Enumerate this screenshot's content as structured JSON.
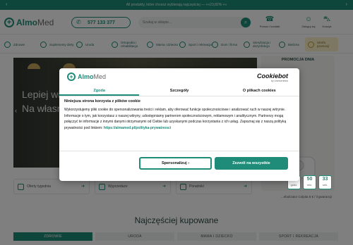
{
  "topbar": {
    "text": "All produkty, które chcesz wybierają najczęściej — +»23,82% +«",
    "prev": "‹",
    "next": "›"
  },
  "header": {
    "logo_a": "Almo",
    "logo_b": "Med",
    "phone": "577 133 377",
    "search_placeholder": "Szukaj w sklepie...",
    "icons": [
      {
        "name": "kontakt",
        "label": "Pomoc i kontakt",
        "glyph": "☎"
      },
      {
        "name": "account",
        "label": "Zaloguj się",
        "glyph": "☺"
      },
      {
        "name": "cart",
        "label": "Koszyk",
        "glyph": "⛍"
      }
    ]
  },
  "categories": [
    {
      "label": "Zdrowie"
    },
    {
      "label": "Suplementy diety"
    },
    {
      "label": "Uroda"
    },
    {
      "label": "Ortopedia i rehabilitacja"
    },
    {
      "label": "Mama i dziecko"
    },
    {
      "label": "Sport i rekreacja"
    },
    {
      "label": "Dom i firma"
    },
    {
      "label": "Sterylizacja i dezynfekcja"
    },
    {
      "label": "Bielizna"
    },
    {
      "label": "Strefa promocji"
    }
  ],
  "hero": {
    "title_line1": "Lepiej wi",
    "title_line2": "Na własn"
  },
  "promo": {
    "title": "PROMOCJA DNIA",
    "product_name": "…ebulizator Colpita 8 € / il gwarancji",
    "countdown": [
      {
        "value": "12",
        "unit": "godz."
      },
      {
        "value": "50",
        "unit": "min."
      },
      {
        "value": "33",
        "unit": "sek."
      }
    ]
  },
  "tiles": [
    {
      "label": "Oferty tygodnia"
    },
    {
      "label": "Wyprzedaże"
    },
    {
      "label": "Poradniki"
    }
  ],
  "section": {
    "title": "Najczęściej kupowane",
    "tabs": [
      "ZDROWIE",
      "URODA",
      "MAMA I DZIECKO",
      "SPORT I REKREACJA"
    ]
  },
  "cookie": {
    "logo_a": "Almo",
    "logo_b": "Med",
    "brand": "Cookiebot",
    "brand_sub": "by Usercentrics",
    "tabs": [
      "Zgoda",
      "Szczegóły",
      "O plikach cookies"
    ],
    "heading": "Niniejsza strona korzysta z plików cookie",
    "body": "Wykorzystujemy pliki cookie do spersonalizowania treści i reklam, aby oferować funkcje społecznościowe i analizować ruch w naszej witrynie. Informacje o tym, jak korzystasz z naszej witryny, udostępniamy partnerom społecznościowym, reklamowym i analitycznym. Partnerzy mogą połączyć te informacje z innymi danymi otrzymanymi od Ciebie lub uzyskanymi podczas korzystania z ich usług. Zapoznaj się z naszą polityką prywatności pod linkiem:",
    "link": "https://almamed.pl/polityka-prywatnosci",
    "btn_settings": "Spersonalizuj  ›",
    "btn_allow": "Zezwól na wszystkie"
  },
  "colors": {
    "brand": "#1e8c78",
    "overlay": "rgba(0,0,0,0.5)"
  }
}
